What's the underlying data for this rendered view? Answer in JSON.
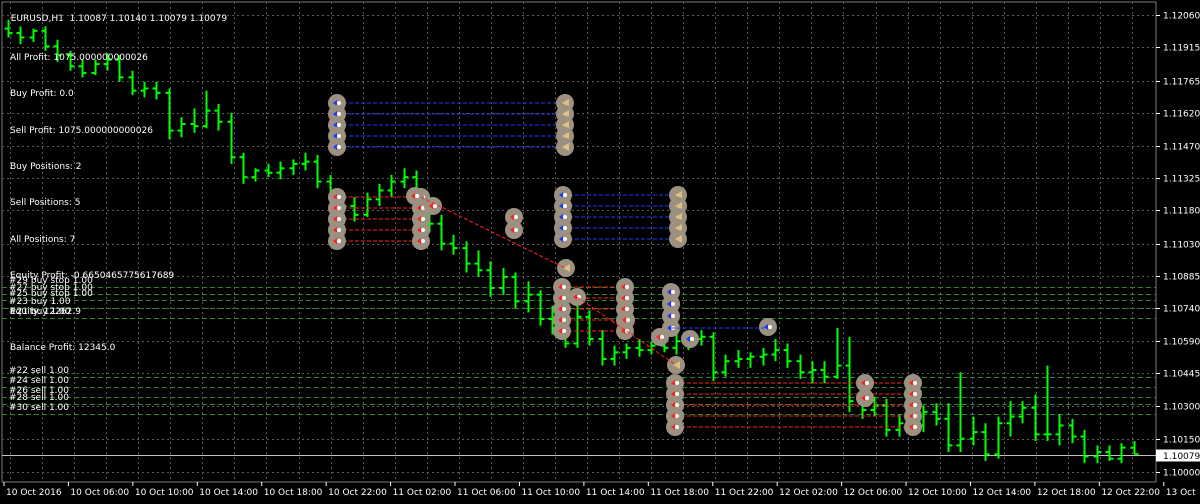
{
  "window": {
    "symbol": "EURUSD,H1",
    "quote": "1.10087 1.10140 1.10079 1.10079"
  },
  "info": [
    "All Profit: 1075.000000000026",
    "Buy Profit: 0.0",
    "Sell Profit: 1075.000000000026",
    "Buy Positions: 2",
    "Sell Positions: 5",
    "All Positions: 7",
    "Equity Profit: -0.6650465775617689",
    "Equity: 12262.9",
    "Balance Profit: 12345.0"
  ],
  "price_axis": {
    "labels": [
      "1.12060",
      "1.11915",
      "1.11765",
      "1.11620",
      "1.11470",
      "1.11325",
      "1.11180",
      "1.11030",
      "1.10885",
      "1.10740",
      "1.10590",
      "1.10445",
      "1.10300",
      "1.10150",
      "1.10000"
    ],
    "current_price": "1.10079",
    "ymax": 1.1212,
    "ymin": 1.09955
  },
  "time_axis": {
    "labels": [
      "10 Oct 2016",
      "10 Oct 06:00",
      "10 Oct 10:00",
      "10 Oct 14:00",
      "10 Oct 18:00",
      "10 Oct 22:00",
      "11 Oct 02:00",
      "11 Oct 06:00",
      "11 Oct 10:00",
      "11 Oct 14:00",
      "11 Oct 18:00",
      "11 Oct 22:00",
      "12 Oct 02:00",
      "12 Oct 06:00",
      "12 Oct 10:00",
      "12 Oct 14:00",
      "12 Oct 18:00",
      "12 Oct 22:00",
      "13 Oct"
    ]
  },
  "orders": {
    "buy": [
      {
        "label": "#29 buy stop 1.00",
        "price": 1.10833
      },
      {
        "label": "#27 buy stop 1.00",
        "price": 1.10805
      },
      {
        "label": "#25 buy stop 1.00",
        "price": 1.10778
      },
      {
        "label": "#23 buy 1.00",
        "price": 1.10741
      },
      {
        "label": "#21 buy 1.00",
        "price": 1.10696
      }
    ],
    "sell": [
      {
        "label": "#22 sell 1.00",
        "price": 1.10428
      },
      {
        "label": "#24 sell 1.00",
        "price": 1.10383
      },
      {
        "label": "#26 sell 1.00",
        "price": 1.10339
      },
      {
        "label": "#28 sell 1.00",
        "price": 1.10305
      },
      {
        "label": "#30 sell 1.00",
        "price": 1.10261
      }
    ]
  },
  "colors": {
    "background": "#000000",
    "grid": "#5a5a5a",
    "bars": "#00ff00",
    "buy_level": "#2a8a2a",
    "sell_level": "#2a8a2a",
    "buy_trade_line": "#1a3aff",
    "sell_trade_line": "#ff2020",
    "marker_ring": "#9c9080",
    "axis_text": "#ffffff"
  },
  "chart_data": {
    "type": "ohlc",
    "title": "EURUSD,H1",
    "bars": [
      [
        1.12,
        1.1204,
        1.1196,
        1.1198
      ],
      [
        1.1198,
        1.1201,
        1.1193,
        1.1196
      ],
      [
        1.1196,
        1.12,
        1.1194,
        1.1199
      ],
      [
        1.1199,
        1.1201,
        1.119,
        1.1192
      ],
      [
        1.1192,
        1.1195,
        1.1185,
        1.1188
      ],
      [
        1.1188,
        1.119,
        1.1181,
        1.1183
      ],
      [
        1.1183,
        1.1186,
        1.1178,
        1.118
      ],
      [
        1.118,
        1.1186,
        1.1179,
        1.1184
      ],
      [
        1.1184,
        1.1189,
        1.1181,
        1.1186
      ],
      [
        1.1186,
        1.1188,
        1.1176,
        1.1178
      ],
      [
        1.1178,
        1.1181,
        1.117,
        1.1172
      ],
      [
        1.1172,
        1.1176,
        1.1169,
        1.1173
      ],
      [
        1.1173,
        1.1176,
        1.1168,
        1.1171
      ],
      [
        1.1171,
        1.1173,
        1.115,
        1.1154
      ],
      [
        1.1154,
        1.116,
        1.1151,
        1.1157
      ],
      [
        1.1157,
        1.1164,
        1.1153,
        1.1156
      ],
      [
        1.1156,
        1.1172,
        1.1155,
        1.1163
      ],
      [
        1.1163,
        1.1166,
        1.1154,
        1.1158
      ],
      [
        1.1158,
        1.1162,
        1.1139,
        1.1142
      ],
      [
        1.1142,
        1.1144,
        1.113,
        1.1133
      ],
      [
        1.1133,
        1.1137,
        1.1131,
        1.1136
      ],
      [
        1.1136,
        1.1139,
        1.1133,
        1.1135
      ],
      [
        1.1135,
        1.114,
        1.1132,
        1.1137
      ],
      [
        1.1137,
        1.1141,
        1.1134,
        1.1139
      ],
      [
        1.1139,
        1.1144,
        1.1136,
        1.114
      ],
      [
        1.114,
        1.1143,
        1.1128,
        1.1131
      ],
      [
        1.1131,
        1.1134,
        1.1122,
        1.1125
      ],
      [
        1.1125,
        1.1127,
        1.1117,
        1.112
      ],
      [
        1.112,
        1.1124,
        1.1113,
        1.1116
      ],
      [
        1.1116,
        1.1126,
        1.1115,
        1.1123
      ],
      [
        1.1123,
        1.113,
        1.112,
        1.1127
      ],
      [
        1.1127,
        1.1134,
        1.1124,
        1.1131
      ],
      [
        1.1131,
        1.1137,
        1.1128,
        1.1133
      ],
      [
        1.1133,
        1.1136,
        1.1117,
        1.112
      ],
      [
        1.112,
        1.1124,
        1.1108,
        1.1112
      ],
      [
        1.1112,
        1.1116,
        1.11,
        1.1103
      ],
      [
        1.1103,
        1.1107,
        1.1098,
        1.1101
      ],
      [
        1.1101,
        1.1104,
        1.109,
        1.1094
      ],
      [
        1.1094,
        1.11,
        1.1088,
        1.1091
      ],
      [
        1.1091,
        1.1095,
        1.1079,
        1.1083
      ],
      [
        1.1083,
        1.1092,
        1.108,
        1.1088
      ],
      [
        1.1088,
        1.109,
        1.1074,
        1.1077
      ],
      [
        1.1077,
        1.1086,
        1.1072,
        1.108
      ],
      [
        1.108,
        1.1082,
        1.1066,
        1.1069
      ],
      [
        1.1069,
        1.1075,
        1.1062,
        1.1065
      ],
      [
        1.1065,
        1.1068,
        1.1056,
        1.1058
      ],
      [
        1.1058,
        1.1075,
        1.1056,
        1.107
      ],
      [
        1.107,
        1.1073,
        1.1057,
        1.106
      ],
      [
        1.106,
        1.1064,
        1.1048,
        1.1051
      ],
      [
        1.1051,
        1.1057,
        1.1048,
        1.1054
      ],
      [
        1.1054,
        1.1058,
        1.1051,
        1.1056
      ],
      [
        1.1056,
        1.106,
        1.1052,
        1.1055
      ],
      [
        1.1055,
        1.1059,
        1.1053,
        1.1057
      ],
      [
        1.1057,
        1.1061,
        1.1054,
        1.1056
      ],
      [
        1.1056,
        1.1064,
        1.1053,
        1.1059
      ],
      [
        1.1059,
        1.1063,
        1.1055,
        1.106
      ],
      [
        1.106,
        1.1064,
        1.1057,
        1.1061
      ],
      [
        1.1061,
        1.1063,
        1.1041,
        1.1045
      ],
      [
        1.1045,
        1.1053,
        1.1043,
        1.105
      ],
      [
        1.105,
        1.1055,
        1.1047,
        1.1051
      ],
      [
        1.1051,
        1.1054,
        1.1047,
        1.1052
      ],
      [
        1.1052,
        1.1056,
        1.1048,
        1.1053
      ],
      [
        1.1053,
        1.106,
        1.105,
        1.1055
      ],
      [
        1.1055,
        1.1058,
        1.1047,
        1.105
      ],
      [
        1.105,
        1.1053,
        1.1042,
        1.1045
      ],
      [
        1.1045,
        1.105,
        1.104,
        1.1046
      ],
      [
        1.1046,
        1.105,
        1.104,
        1.1043
      ],
      [
        1.1043,
        1.1065,
        1.1042,
        1.1048
      ],
      [
        1.1048,
        1.1061,
        1.1027,
        1.1032
      ],
      [
        1.1032,
        1.1036,
        1.1024,
        1.1028
      ],
      [
        1.1028,
        1.1034,
        1.1025,
        1.103
      ],
      [
        1.103,
        1.1033,
        1.1016,
        1.1019
      ],
      [
        1.1019,
        1.1026,
        1.1016,
        1.1022
      ],
      [
        1.1022,
        1.1026,
        1.1018,
        1.1021
      ],
      [
        1.1021,
        1.103,
        1.1018,
        1.1027
      ],
      [
        1.1027,
        1.1031,
        1.1021,
        1.1024
      ],
      [
        1.1024,
        1.1031,
        1.1009,
        1.1012
      ],
      [
        1.1012,
        1.1045,
        1.1009,
        1.1015
      ],
      [
        1.1015,
        1.1025,
        1.1012,
        1.1018
      ],
      [
        1.1018,
        1.1022,
        1.1005,
        1.1008
      ],
      [
        1.1008,
        1.1025,
        1.1006,
        1.1022
      ],
      [
        1.1022,
        1.1032,
        1.1016,
        1.1025
      ],
      [
        1.1025,
        1.1032,
        1.1022,
        1.1029
      ],
      [
        1.1029,
        1.1035,
        1.1014,
        1.1017
      ],
      [
        1.1017,
        1.1048,
        1.1014,
        1.1017
      ],
      [
        1.1017,
        1.1026,
        1.1012,
        1.1021
      ],
      [
        1.1021,
        1.1024,
        1.1013,
        1.1016
      ],
      [
        1.1016,
        1.1019,
        1.1004,
        1.1007
      ],
      [
        1.1007,
        1.1012,
        1.1004,
        1.1009
      ],
      [
        1.1009,
        1.1012,
        1.1005,
        1.1006
      ],
      [
        1.1006,
        1.1013,
        1.1004,
        1.1011
      ],
      [
        1.1011,
        1.1014,
        1.1008,
        1.1008
      ]
    ],
    "buy_stop_levels": [
      1.10833,
      1.10805,
      1.10778
    ],
    "buy_levels": [
      1.10741,
      1.10696
    ],
    "sell_levels": [
      1.10428,
      1.10383,
      1.10339,
      1.10305,
      1.10261
    ],
    "ylim": [
      1.0996,
      1.1212
    ]
  }
}
